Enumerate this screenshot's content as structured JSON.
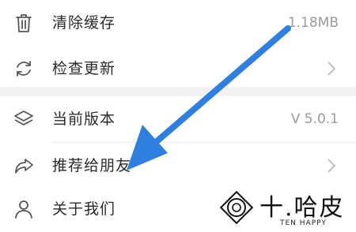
{
  "settings": {
    "items": [
      {
        "label": "清除缓存",
        "value": "1.18MB",
        "icon": "trash-icon"
      },
      {
        "label": "检查更新",
        "icon": "refresh-icon",
        "has_chevron": true
      },
      {
        "label": "当前版本",
        "value": "V 5.0.1",
        "icon": "layers-icon"
      },
      {
        "label": "推荐给朋友",
        "icon": "share-icon",
        "has_chevron": true
      },
      {
        "label": "关于我们",
        "icon": "user-icon"
      }
    ]
  },
  "overlay": {
    "arrow_color": "#2f7fe0",
    "icon": "blue-arrow-annotation"
  },
  "watermark": {
    "brand_cn": "十.哈皮",
    "brand_en": "TEN HAPPY"
  }
}
